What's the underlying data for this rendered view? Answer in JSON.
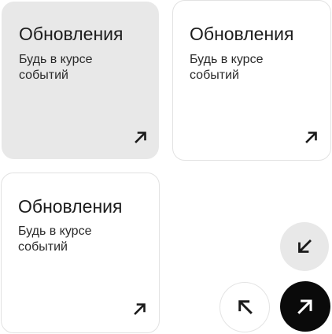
{
  "cards": [
    {
      "style": "filled",
      "title": "Обновления",
      "description": "Будь в курсе событий",
      "arrow_icon": "arrow-up-right-icon"
    },
    {
      "style": "outlined",
      "title": "Обновления",
      "description": "Будь в курсе событий",
      "arrow_icon": "arrow-up-right-icon"
    },
    {
      "style": "outlined",
      "title": "Обновления",
      "description": "Будь в курсе событий",
      "arrow_icon": "arrow-up-right-icon"
    }
  ],
  "buttons": [
    {
      "style": "soft",
      "icon": "arrow-down-left-icon"
    },
    {
      "style": "outline",
      "icon": "arrow-up-left-icon"
    },
    {
      "style": "dark",
      "icon": "arrow-up-right-icon"
    }
  ],
  "colors": {
    "filled_card_bg": "#e8e8e8",
    "outline_border": "#e2e2e2",
    "dark_button_bg": "#0a0a0a",
    "icon_dark": "#1a1a1a",
    "icon_light": "#ffffff"
  }
}
